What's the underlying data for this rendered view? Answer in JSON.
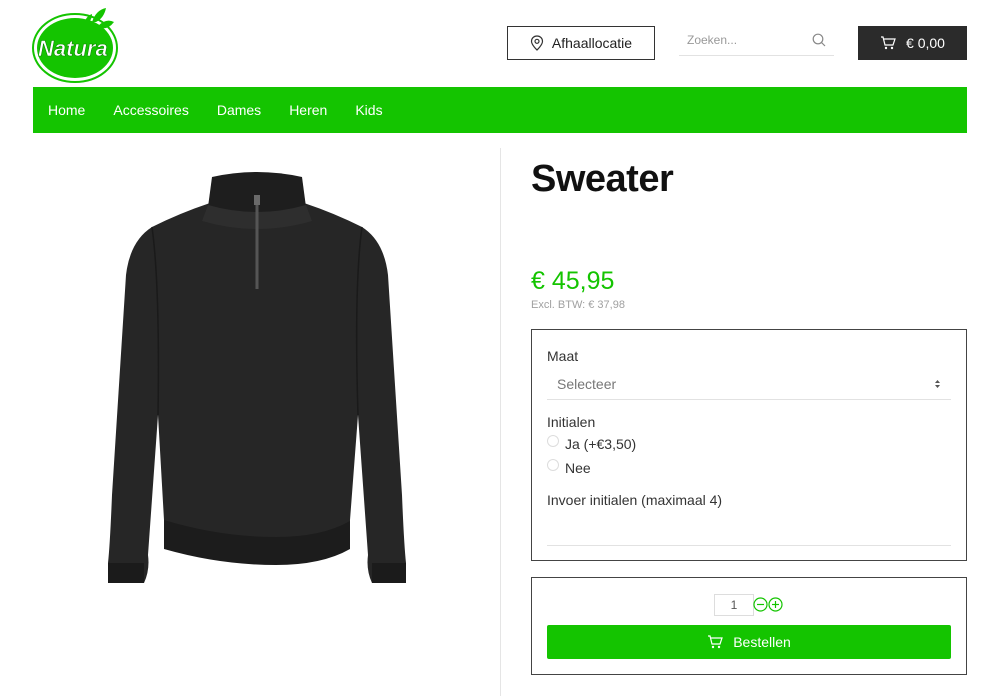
{
  "brand": {
    "logo_text": "Natura",
    "color": "#14c400"
  },
  "header": {
    "pickup_label": "Afhaallocatie",
    "search_placeholder": "Zoeken...",
    "cart_total": "€ 0,00"
  },
  "nav": {
    "items": [
      "Home",
      "Accessoires",
      "Dames",
      "Heren",
      "Kids"
    ],
    "background": "#14c400"
  },
  "product": {
    "title": "Sweater",
    "price": "€ 45,95",
    "price_excl": "Excl. BTW: € 37,98"
  },
  "options": {
    "size_label": "Maat",
    "size_value": "Selecteer",
    "initials_label": "Initialen",
    "initials_options": [
      "Ja (+€3,50)",
      "Nee"
    ],
    "initials_input_label": "Invoer initialen (maximaal 4)"
  },
  "order": {
    "quantity": "1",
    "button_label": "Bestellen"
  },
  "icons": {
    "pickup": "map-pin-icon",
    "search": "search-icon",
    "cart": "cart-icon",
    "minus": "minus-circle-icon",
    "plus": "plus-circle-icon"
  }
}
